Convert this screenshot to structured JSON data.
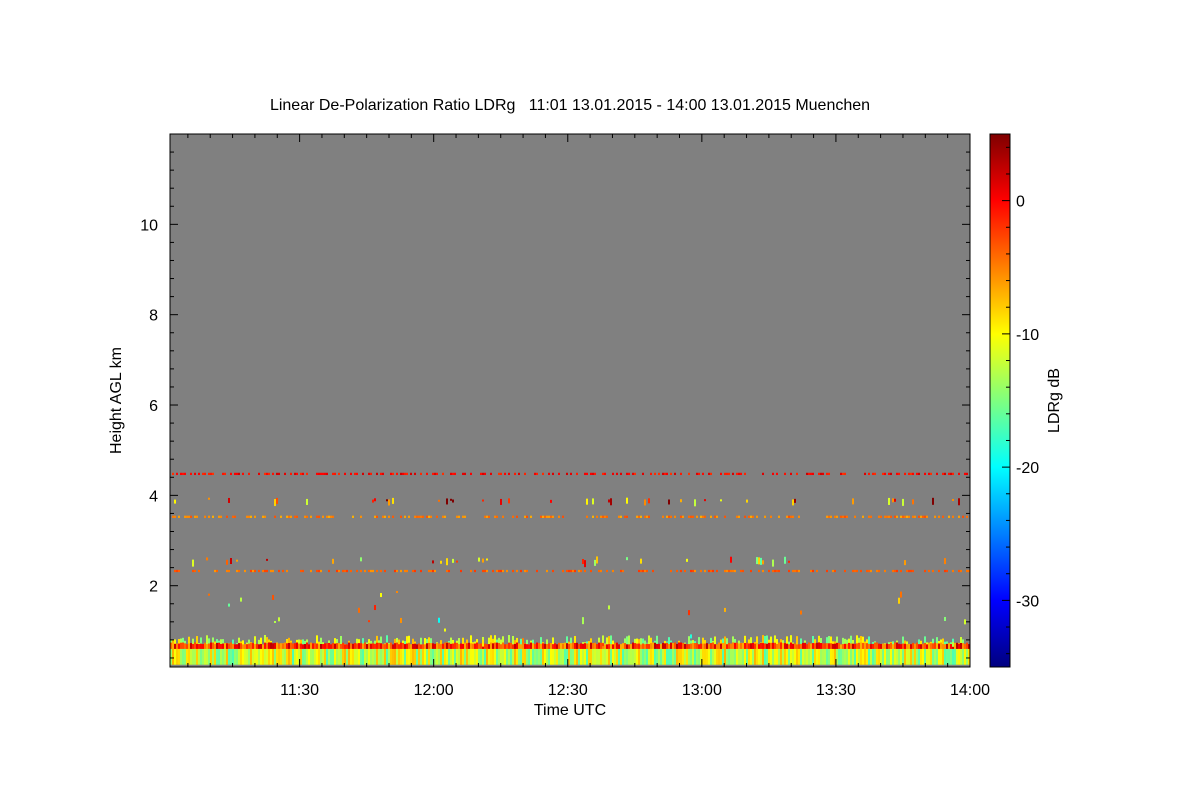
{
  "chart_data": {
    "type": "heatmap",
    "title": "Linear De-Polarization Ratio LDRg   11:01 13.01.2015 - 14:00 13.01.2015 Muenchen",
    "xlabel": "Time UTC",
    "ylabel": "Height AGL km",
    "colorbar_label": "LDRg dB",
    "x_range": [
      "11:01",
      "14:00"
    ],
    "x_ticks": [
      "11:30",
      "12:00",
      "12:30",
      "13:00",
      "13:30",
      "14:00"
    ],
    "ylim": [
      0.2,
      12.0
    ],
    "y_ticks": [
      2,
      4,
      6,
      8,
      10
    ],
    "colorbar_range": [
      -35,
      5
    ],
    "colorbar_ticks": [
      0,
      -10,
      -20,
      -30
    ],
    "background_color": "#808080",
    "colormap": [
      "#00007f",
      "#0000ff",
      "#007fff",
      "#00ffff",
      "#7fff7f",
      "#ffff00",
      "#ff7f00",
      "#ff0000",
      "#7f0000"
    ],
    "layers": [
      {
        "height_km": [
          0.25,
          0.6
        ],
        "ldr_db": -12,
        "coverage": "continuous"
      },
      {
        "height_km": [
          0.6,
          0.7
        ],
        "ldr_db": -2,
        "coverage": "continuous"
      },
      {
        "height_km": [
          0.7,
          1.9
        ],
        "ldr_db": -10,
        "coverage": "sparse"
      },
      {
        "height_km": [
          2.3,
          2.35
        ],
        "ldr_db": -4,
        "coverage": "intermittent"
      },
      {
        "height_km": [
          2.55,
          2.65
        ],
        "ldr_db": -7,
        "coverage": "sparse"
      },
      {
        "height_km": [
          3.5,
          3.55
        ],
        "ldr_db": -5,
        "coverage": "intermittent"
      },
      {
        "height_km": [
          3.9,
          3.95
        ],
        "ldr_db": -3,
        "coverage": "sparse"
      },
      {
        "height_km": [
          4.45,
          4.5
        ],
        "ldr_db": 0,
        "coverage": "intermittent"
      }
    ]
  }
}
